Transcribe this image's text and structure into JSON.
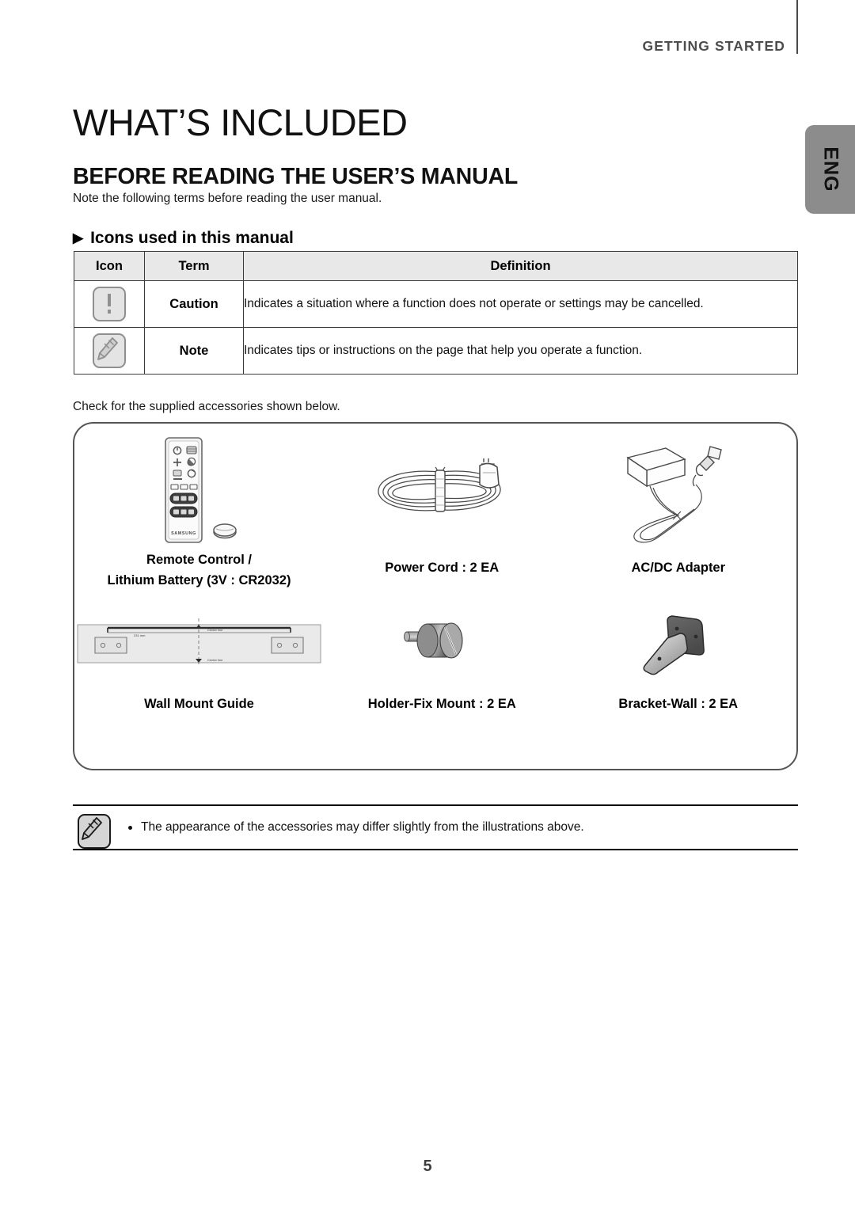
{
  "header": {
    "running_head": "GETTING STARTED",
    "side_tab": "ENG"
  },
  "titles": {
    "chapter": "WHAT’S INCLUDED",
    "section": "BEFORE READING THE USER’S MANUAL",
    "intro": "Note the following terms before reading the user manual.",
    "sub_head_marker": "▶",
    "sub_head": "Icons used in this manual"
  },
  "icon_table": {
    "columns": [
      "Icon",
      "Term",
      "Definition"
    ],
    "rows": [
      {
        "icon": "caution-icon",
        "term": "Caution",
        "definition": "Indicates a situation where a function does not operate or settings may be cancelled."
      },
      {
        "icon": "note-icon",
        "term": "Note",
        "definition": "Indicates tips or instructions on the page that help you operate a function."
      }
    ]
  },
  "accessories": {
    "intro": "Check for the supplied accessories shown below.",
    "items": [
      {
        "art": "remote-control-illustration",
        "label": "Remote Control /\nLithium Battery (3V : CR2032)"
      },
      {
        "art": "power-cord-illustration",
        "label": "Power Cord : 2 EA"
      },
      {
        "art": "ac-dc-adapter-illustration",
        "label": "AC/DC Adapter"
      },
      {
        "art": "wall-mount-guide-illustration",
        "label": "Wall Mount Guide"
      },
      {
        "art": "holder-fix-mount-illustration",
        "label": "Holder-Fix Mount : 2 EA"
      },
      {
        "art": "bracket-wall-illustration",
        "label": "Bracket-Wall : 2 EA"
      }
    ]
  },
  "footer_note": {
    "icon": "note-icon",
    "bullet": "The appearance of the accessories may differ slightly from the illustrations above."
  },
  "page_number": "5",
  "colors": {
    "running_head": "#4d4d4d",
    "side_tab_bg": "#8c8c8c",
    "table_header_bg": "#e8e8e8",
    "table_border": "#3a3a3a",
    "box_border": "#555555",
    "icon_gray": "#8f8f8f",
    "page_number": "#3d3d3d"
  },
  "remote": {
    "brand": "SAMSUNG"
  }
}
